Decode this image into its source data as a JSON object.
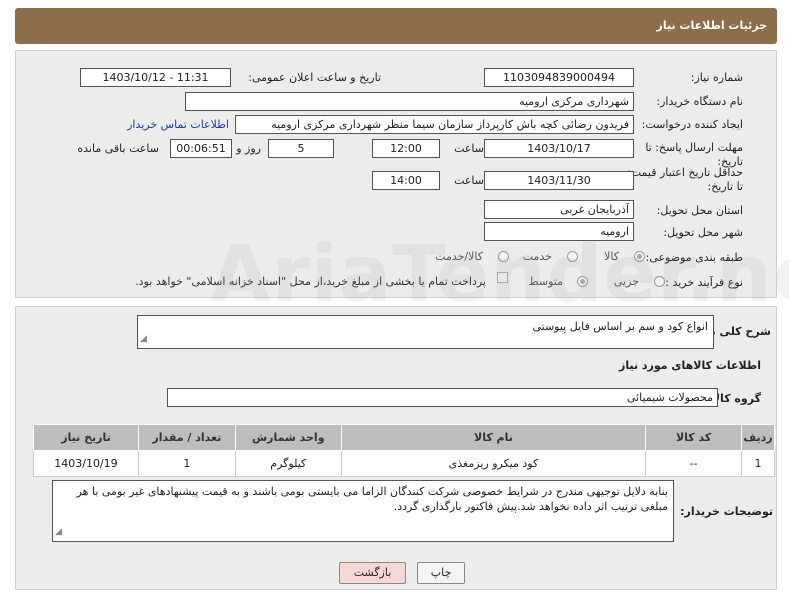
{
  "header": {
    "title": "جزئیات اطلاعات نیاز"
  },
  "form": {
    "need_number_label": "شماره نیاز:",
    "need_number": "1103094839000494",
    "announce_label": "تاریخ و ساعت اعلان عمومی:",
    "announce_value": "1403/10/12 - 11:31",
    "buyer_org_label": "نام دستگاه خریدار:",
    "buyer_org": "شهرداری مرکزی ارومیه",
    "creator_label": "ایجاد کننده درخواست:",
    "creator": "فریدون رضائی کچه باش کارپرداز سازمان سیما منظر شهرداری مرکزی ارومیه",
    "contact_link": "اطلاعات تماس خریدار",
    "deadline_label": "مهلت ارسال پاسخ: تا تاریخ:",
    "deadline_date": "1403/10/17",
    "time_label": "ساعت",
    "deadline_time": "12:00",
    "days_value": "5",
    "days_label": "روز و",
    "remaining_time": "00:06:51",
    "remaining_label": "ساعت باقی مانده",
    "validity_label": "حداقل تاریخ اعتبار قیمت: تا تاریخ:",
    "validity_date": "1403/11/30",
    "validity_time": "14:00",
    "province_label": "استان محل تحویل:",
    "province": "آذربایجان غربی",
    "city_label": "شهر محل تحویل:",
    "city": "ارومیه",
    "category_label": "طبقه بندی موضوعی:",
    "category_options": [
      "کالا",
      "خدمت",
      "کالا/خدمت"
    ],
    "process_label": "نوع فرآیند خرید :",
    "process_options": [
      "جزیی",
      "متوسط"
    ],
    "payment_note": "پرداخت تمام یا بخشی از مبلغ خرید،از محل \"اسناد خزانه اسلامی\" خواهد بود."
  },
  "details": {
    "description_label": "شرح کلی نیاز:",
    "description": "انواع کود و سم بر اساس فایل پیوستی",
    "goods_info_title": "اطلاعات کالاهای مورد نیاز",
    "goods_group_label": "گروه کالا:",
    "goods_group": "محصولات شیمیائی",
    "table": {
      "headers": [
        "ردیف",
        "کد کالا",
        "نام کالا",
        "واحد شمارش",
        "تعداد / مقدار",
        "تاریخ نیاز"
      ],
      "rows": [
        [
          "1",
          "--",
          "کود میکرو ریزمغذی",
          "کیلوگرم",
          "1",
          "1403/10/19"
        ]
      ]
    },
    "buyer_notes_label": "توضیحات خریدار:",
    "buyer_notes": "بنابه دلایل توجیهی مندرج در شرایط خصوصی شرکت کنندگان الزاما می بایستی بومی باشند و به قیمت پیشنهادهای غیر بومی با هر مبلغی ترتیب اثر داده نخواهد شد.پیش فاکتور بارگذاری گردد."
  },
  "buttons": {
    "print": "چاپ",
    "back": "بازگشت"
  },
  "watermark": "AriaTender.net",
  "colors": {
    "header_bg": "#8c6f4a",
    "link": "#1a3fa0",
    "back_btn_bg": "#f7d6d6"
  }
}
